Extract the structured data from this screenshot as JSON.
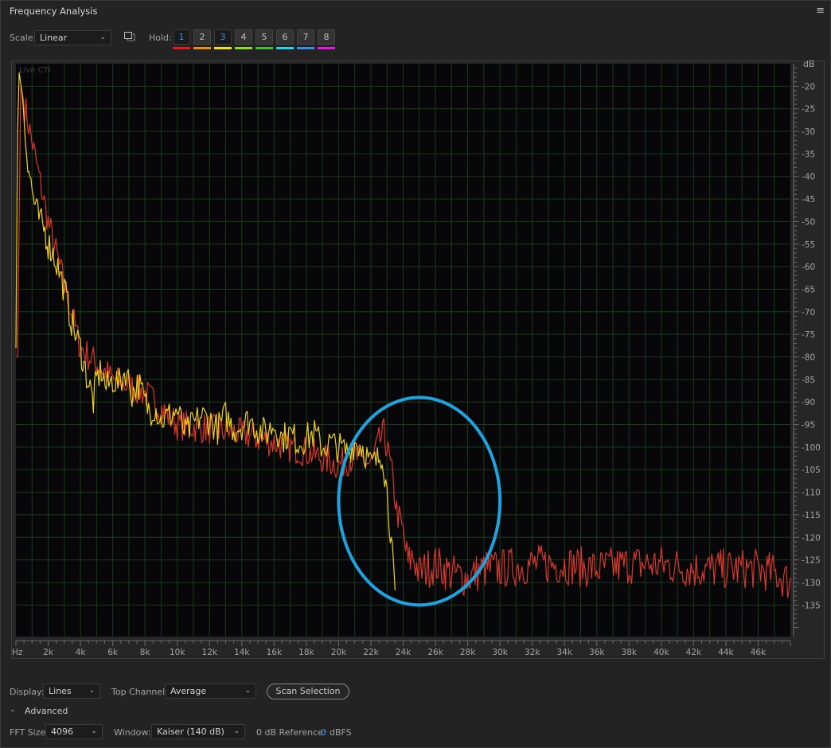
{
  "panel": {
    "title": "Frequency Analysis",
    "menu_icon": "hamburger-icon"
  },
  "toolbar": {
    "scale_label": "Scale:",
    "scale_value": "Linear",
    "hold_label": "Hold:",
    "hold_buttons": [
      {
        "label": "1",
        "color": "#e01b1b"
      },
      {
        "label": "2",
        "color": "#f08a17"
      },
      {
        "label": "3",
        "color": "#f0e21a"
      },
      {
        "label": "4",
        "color": "#8adf1d"
      },
      {
        "label": "5",
        "color": "#3fbf3a"
      },
      {
        "label": "6",
        "color": "#23d6e6"
      },
      {
        "label": "7",
        "color": "#3a8de6"
      },
      {
        "label": "8",
        "color": "#e61ae0"
      }
    ]
  },
  "chart_data": {
    "type": "line",
    "overlay_label": "Live CTI",
    "x_unit_label": "Hz",
    "y_unit_label": "dB",
    "xlim": [
      0,
      48000
    ],
    "ylim": [
      -142,
      -15
    ],
    "x_ticks": [
      {
        "v": 2000,
        "label": "2k"
      },
      {
        "v": 4000,
        "label": "4k"
      },
      {
        "v": 6000,
        "label": "6k"
      },
      {
        "v": 8000,
        "label": "8k"
      },
      {
        "v": 10000,
        "label": "10k"
      },
      {
        "v": 12000,
        "label": "12k"
      },
      {
        "v": 14000,
        "label": "14k"
      },
      {
        "v": 16000,
        "label": "16k"
      },
      {
        "v": 18000,
        "label": "18k"
      },
      {
        "v": 20000,
        "label": "20k"
      },
      {
        "v": 22000,
        "label": "22k"
      },
      {
        "v": 24000,
        "label": "24k"
      },
      {
        "v": 26000,
        "label": "26k"
      },
      {
        "v": 28000,
        "label": "28k"
      },
      {
        "v": 30000,
        "label": "30k"
      },
      {
        "v": 32000,
        "label": "32k"
      },
      {
        "v": 34000,
        "label": "34k"
      },
      {
        "v": 36000,
        "label": "36k"
      },
      {
        "v": 38000,
        "label": "38k"
      },
      {
        "v": 40000,
        "label": "40k"
      },
      {
        "v": 42000,
        "label": "42k"
      },
      {
        "v": 44000,
        "label": "44k"
      },
      {
        "v": 46000,
        "label": "46k"
      }
    ],
    "y_ticks": [
      {
        "v": -20,
        "label": "-20"
      },
      {
        "v": -25,
        "label": "-25"
      },
      {
        "v": -30,
        "label": "-30"
      },
      {
        "v": -35,
        "label": "-35"
      },
      {
        "v": -40,
        "label": "-40"
      },
      {
        "v": -45,
        "label": "-45"
      },
      {
        "v": -50,
        "label": "-50"
      },
      {
        "v": -55,
        "label": "-55"
      },
      {
        "v": -60,
        "label": "-60"
      },
      {
        "v": -65,
        "label": "-65"
      },
      {
        "v": -70,
        "label": "-70"
      },
      {
        "v": -75,
        "label": "-75"
      },
      {
        "v": -80,
        "label": "-80"
      },
      {
        "v": -85,
        "label": "-85"
      },
      {
        "v": -90,
        "label": "-90"
      },
      {
        "v": -95,
        "label": "-95"
      },
      {
        "v": -100,
        "label": "-100"
      },
      {
        "v": -105,
        "label": "-105"
      },
      {
        "v": -110,
        "label": "-110"
      },
      {
        "v": -115,
        "label": "-115"
      },
      {
        "v": -120,
        "label": "-120"
      },
      {
        "v": -125,
        "label": "-125"
      },
      {
        "v": -130,
        "label": "-130"
      },
      {
        "v": -135,
        "label": "-135"
      }
    ],
    "grid": true,
    "series": [
      {
        "color": "#d9382c",
        "x": [
          0,
          100,
          300,
          2000,
          4000,
          6000,
          8000,
          10000,
          12000,
          14000,
          16000,
          18000,
          20000,
          21000,
          22000,
          22500,
          22800,
          23000,
          23300,
          23600,
          24000,
          24300,
          24600,
          25000,
          25400,
          26000,
          27000,
          28000,
          29000,
          30000,
          32000,
          34000,
          36000,
          38000,
          40000,
          42000,
          44000,
          46000,
          47000,
          47500,
          48000
        ],
        "y": [
          -80,
          -80,
          -20,
          -50,
          -78,
          -85,
          -88,
          -95,
          -96,
          -97,
          -99,
          -101,
          -104,
          -102,
          -104,
          -99,
          -97,
          -100,
          -106,
          -114,
          -119,
          -126,
          -124,
          -128,
          -127,
          -126,
          -128,
          -129,
          -127,
          -127,
          -126,
          -126,
          -127,
          -126,
          -126,
          -127,
          -127,
          -127,
          -128,
          -129,
          -130
        ]
      },
      {
        "color": "#f0d21a",
        "x": [
          0,
          100,
          200,
          400,
          600,
          800,
          1000,
          1200,
          1500,
          1800,
          2000,
          2300,
          2600,
          3000,
          3300,
          3600,
          4000,
          4300,
          4600,
          4800,
          5000,
          5300,
          5600,
          6000,
          6400,
          6800,
          7200,
          7600,
          8000,
          8300,
          8600,
          9000,
          9500,
          10000,
          10500,
          11000,
          11500,
          12000,
          12500,
          13000,
          13500,
          14000,
          14500,
          15000,
          15500,
          16000,
          16500,
          17000,
          17500,
          18000,
          18500,
          19000,
          19500,
          20000,
          20500,
          21000,
          21500,
          22000,
          22400,
          22700,
          23000,
          23200,
          23400,
          23500
        ],
        "y": [
          -78,
          -30,
          -17,
          -22,
          -32,
          -38,
          -43,
          -47,
          -50,
          -52,
          -55,
          -57,
          -60,
          -65,
          -70,
          -74,
          -78,
          -83,
          -87,
          -90,
          -85,
          -83,
          -87,
          -85,
          -86,
          -83,
          -88,
          -86,
          -90,
          -92,
          -91,
          -94,
          -93,
          -92,
          -97,
          -95,
          -93,
          -94,
          -96,
          -93,
          -96,
          -95,
          -94,
          -96,
          -97,
          -95,
          -98,
          -97,
          -99,
          -98,
          -97,
          -100,
          -99,
          -100,
          -101,
          -99,
          -100,
          -104,
          -103,
          -101,
          -110,
          -118,
          -128,
          -134
        ]
      }
    ],
    "annotation": {
      "type": "ellipse",
      "color": "#1fa3e0",
      "center": [
        25000,
        -112
      ],
      "rx_hz": 5000,
      "ry_db": 23
    }
  },
  "bottom": {
    "display_label": "Display:",
    "display_value": "Lines",
    "top_channel_label": "Top Channel:",
    "top_channel_value": "Average",
    "scan_button": "Scan Selection",
    "advanced_label": "Advanced",
    "fft_label": "FFT Size:",
    "fft_value": "4096",
    "window_label": "Window:",
    "window_value": "Kaiser (140 dB)",
    "ref_label": "0 dB Reference:",
    "ref_value": "0",
    "ref_unit": "dBFS"
  }
}
